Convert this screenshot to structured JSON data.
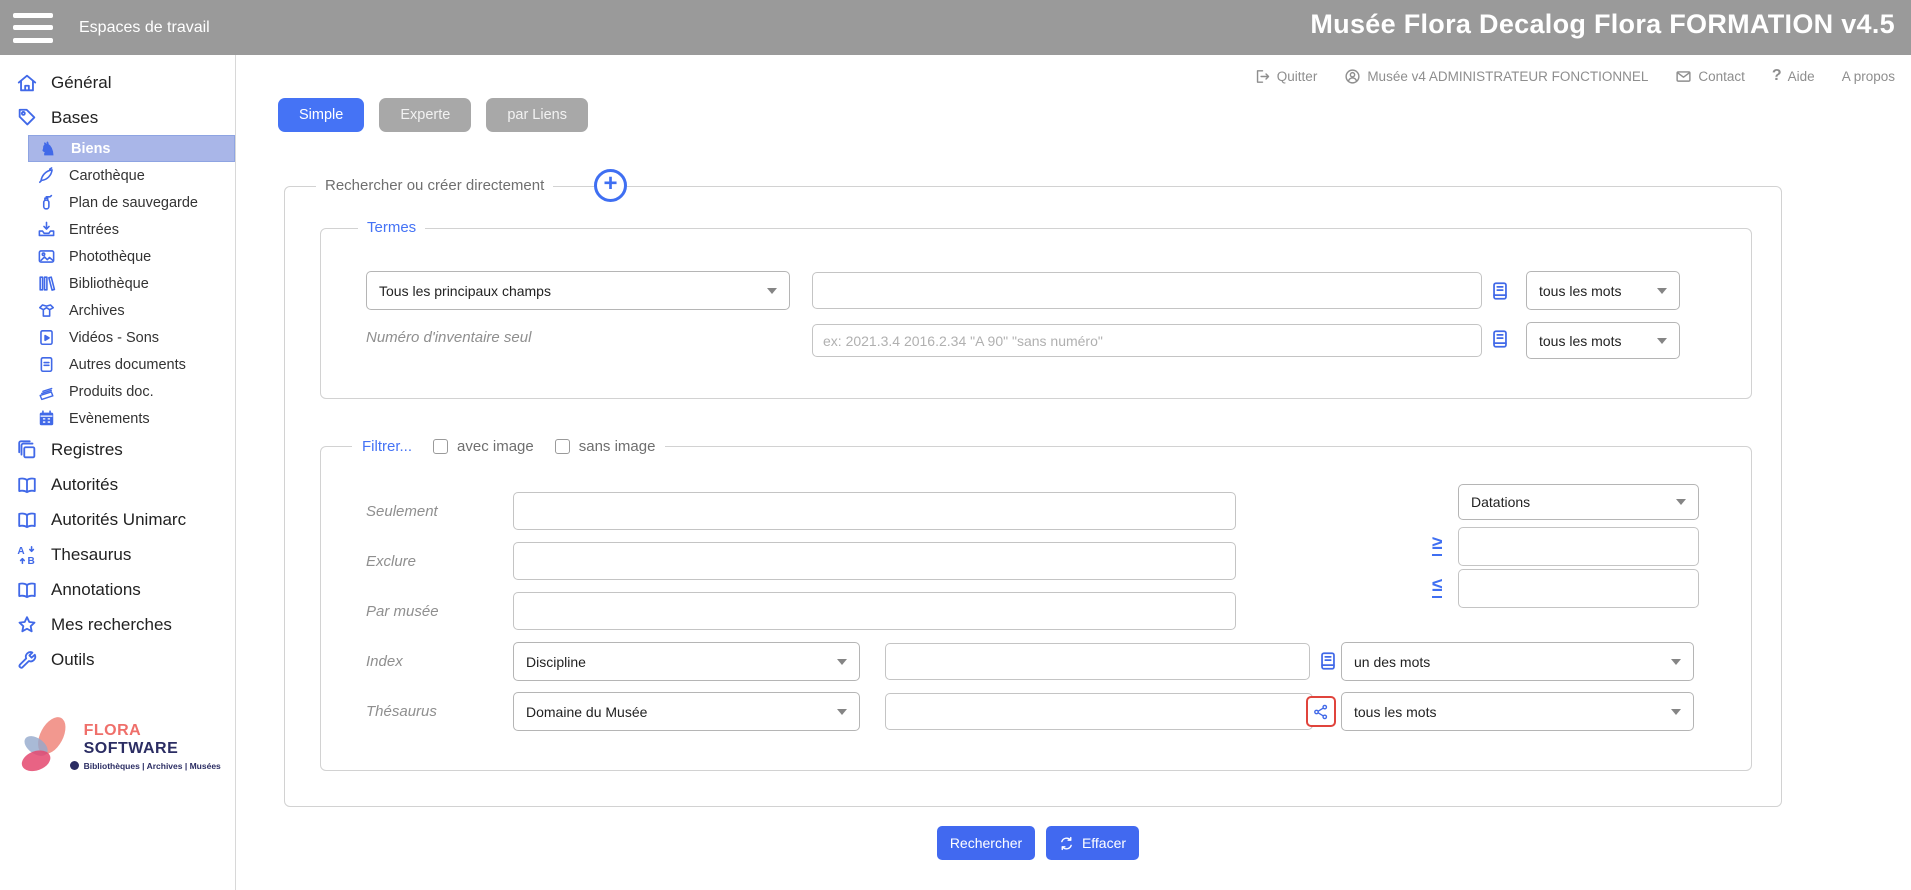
{
  "topbar": {
    "workspace_label": "Espaces de travail",
    "app_title": "Musée Flora Decalog Flora FORMATION v4.5"
  },
  "userbar": {
    "quitter": "Quitter",
    "user": "Musée v4 ADMINISTRATEUR FONCTIONNEL",
    "contact": "Contact",
    "aide": "Aide",
    "a_propos": "A propos",
    "aide_icon_glyph": "?"
  },
  "tabs": {
    "simple": "Simple",
    "experte": "Experte",
    "par_liens": "par Liens",
    "active": "Simple"
  },
  "sidebar": {
    "entries": [
      {
        "label": "Général",
        "icon": "house-icon",
        "level": 1
      },
      {
        "label": "Bases",
        "icon": "tag-icon",
        "level": 1
      },
      {
        "label": "Biens",
        "icon": "chess-knight-icon",
        "level": 2,
        "selected": true
      },
      {
        "label": "Carothèque",
        "icon": "core-sample-icon",
        "level": 2
      },
      {
        "label": "Plan de sauvegarde",
        "icon": "fire-extinguisher-icon",
        "level": 2
      },
      {
        "label": "Entrées",
        "icon": "inbox-download-icon",
        "level": 2
      },
      {
        "label": "Photothèque",
        "icon": "image-icon",
        "level": 2
      },
      {
        "label": "Bibliothèque",
        "icon": "library-icon",
        "level": 2
      },
      {
        "label": "Archives",
        "icon": "archive-box-icon",
        "level": 2
      },
      {
        "label": "Vidéos - Sons",
        "icon": "video-file-icon",
        "level": 2
      },
      {
        "label": "Autres documents",
        "icon": "document-icon",
        "level": 2
      },
      {
        "label": "Produits doc.",
        "icon": "paper-stack-icon",
        "level": 2
      },
      {
        "label": "Evènements",
        "icon": "calendar-icon",
        "level": 2
      },
      {
        "label": "Registres",
        "icon": "registers-icon",
        "level": 1
      },
      {
        "label": "Autorités",
        "icon": "open-book-icon",
        "level": 1
      },
      {
        "label": "Autorités Unimarc",
        "icon": "open-book-icon",
        "level": 1
      },
      {
        "label": "Thesaurus",
        "icon": "translate-icon",
        "level": 1
      },
      {
        "label": "Annotations",
        "icon": "open-book-icon",
        "level": 1
      },
      {
        "label": "Mes recherches",
        "icon": "star-icon",
        "level": 1
      },
      {
        "label": "Outils",
        "icon": "wrench-icon",
        "level": 1
      }
    ],
    "knight_glyph": "♞"
  },
  "logo": {
    "brand_1": "FLORA",
    "brand_2": "SOFTWARE",
    "tagline": "Bibliothèques | Archives | Musées"
  },
  "search_form": {
    "legend": "Rechercher ou créer directement",
    "plus_glyph": "+",
    "termes": {
      "legend": "Termes",
      "field_scope_value": "Tous les principaux champs",
      "main_match_value": "tous les mots",
      "inventory_label": "Numéro d'inventaire seul",
      "inventory_placeholder": "ex: 2021.3.4 2016.2.34 \"A 90\" \"sans numéro\"",
      "inventory_match_value": "tous les mots"
    },
    "filter": {
      "legend": "Filtrer...",
      "avec_image_label": "avec image",
      "sans_image_label": "sans image",
      "seulement_label": "Seulement",
      "exclure_label": "Exclure",
      "par_musee_label": "Par musée",
      "index_label": "Index",
      "index_field_value": "Discipline",
      "index_match_value": "un des mots",
      "thesaurus_label": "Thésaurus",
      "thesaurus_field_value": "Domaine du Musée",
      "thesaurus_match_value": "tous les mots",
      "datations_value": "Datations",
      "gte_symbol": "≥",
      "lte_symbol": "≤"
    },
    "actions": {
      "rechercher": "Rechercher",
      "effacer": "Effacer"
    }
  },
  "colors": {
    "topbar_gray": "#9a9a9a",
    "accent_blue": "#4573f5",
    "icon_blue": "#4169e8",
    "button_blue": "#4169f0",
    "selected_row_bg": "#a9b6e8",
    "alert_red": "#e0443c"
  }
}
